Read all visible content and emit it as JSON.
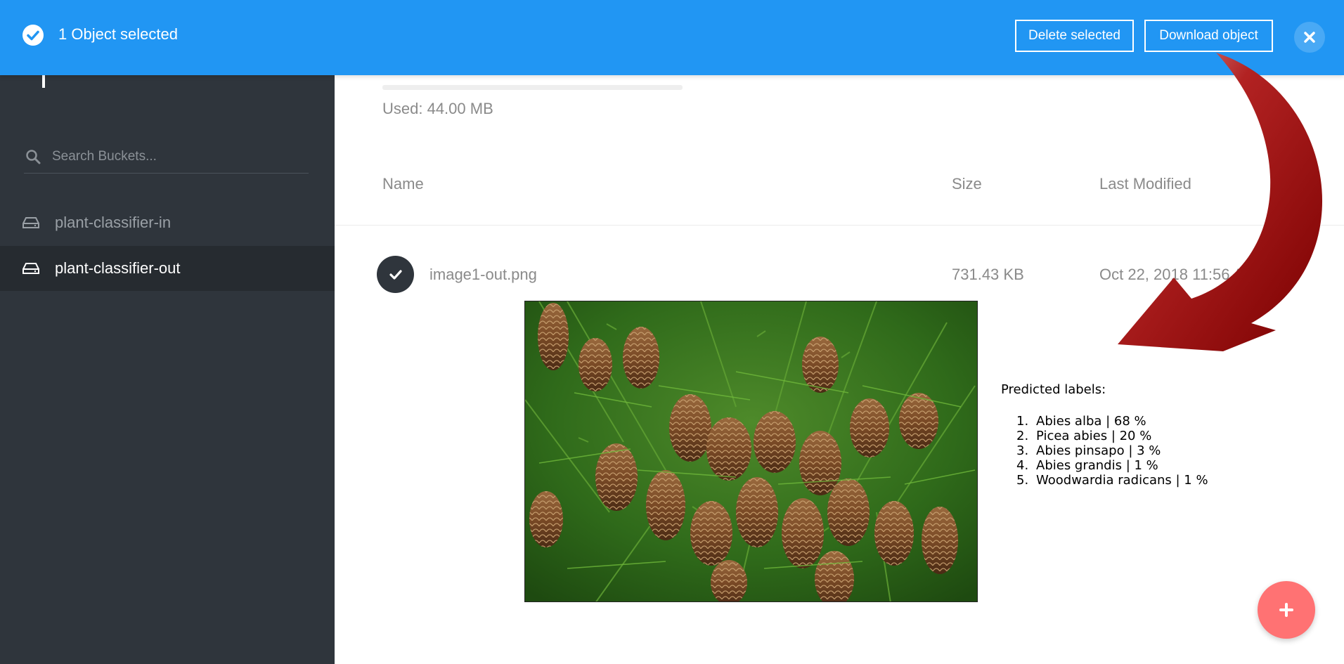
{
  "topbar": {
    "selected_text": "1 Object selected",
    "delete_label": "Delete selected",
    "download_label": "Download object",
    "color": "#2196f3"
  },
  "sidebar": {
    "search_placeholder": "Search Buckets...",
    "buckets": [
      {
        "label": "plant-classifier-in",
        "active": false
      },
      {
        "label": "plant-classifier-out",
        "active": true
      }
    ]
  },
  "main": {
    "used": "Used: 44.00 MB",
    "columns": {
      "name": "Name",
      "size": "Size",
      "modified": "Last Modified"
    },
    "rows": [
      {
        "name": "image1-out.png",
        "size": "731.43 KB",
        "modified": "Oct 22, 2018 11:56 AM",
        "selected": true
      }
    ]
  },
  "preview": {
    "title": "Predicted labels:",
    "labels": [
      {
        "num": "1.",
        "text": "Abies alba | 68 %"
      },
      {
        "num": "2.",
        "text": "Picea abies | 20 %"
      },
      {
        "num": "3.",
        "text": "Abies pinsapo | 3 %"
      },
      {
        "num": "4.",
        "text": "Abies grandis | 1 %"
      },
      {
        "num": "5.",
        "text": "Woodwardia radicans | 1 %"
      }
    ]
  },
  "colors": {
    "accent": "#2196f3",
    "fab": "#ff7273",
    "arrow": "#8b0000",
    "sidebar": "#2f353c"
  },
  "icons": [
    "check-circle-icon",
    "close-icon",
    "search-icon",
    "drive-icon",
    "checkmark-icon",
    "plus-icon"
  ]
}
